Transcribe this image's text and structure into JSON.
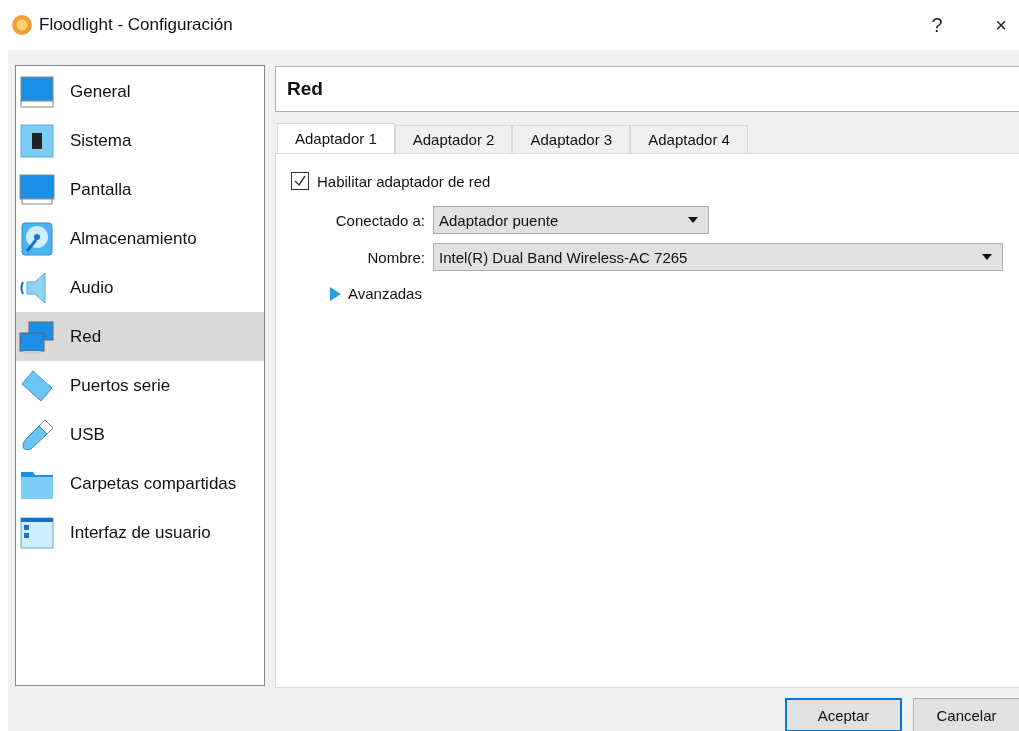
{
  "window": {
    "title": "Floodlight - Configuración",
    "buttons": [
      "?",
      "×"
    ]
  },
  "sidebar": {
    "items": [
      {
        "label": "General",
        "selected": false
      },
      {
        "label": "Sistema",
        "selected": false
      },
      {
        "label": "Pantalla",
        "selected": false
      },
      {
        "label": "Almacenamiento",
        "selected": false
      },
      {
        "label": "Audio",
        "selected": false
      },
      {
        "label": "Red",
        "selected": true
      },
      {
        "label": "Puertos serie",
        "selected": false
      },
      {
        "label": "USB",
        "selected": false
      },
      {
        "label": "Carpetas compartidas",
        "selected": false
      },
      {
        "label": "Interfaz de usuario",
        "selected": false
      }
    ]
  },
  "page": {
    "title": "Red",
    "tabs": [
      {
        "label": "Adaptador 1",
        "selected": true
      },
      {
        "label": "Adaptador 2",
        "selected": false
      },
      {
        "label": "Adaptador 3",
        "selected": false
      },
      {
        "label": "Adaptador 4",
        "selected": false
      }
    ],
    "enable": {
      "label": "Habilitar adaptador de red",
      "checked": true
    },
    "fields": [
      {
        "label": "Conectado a:",
        "value": "Adaptador puente",
        "wide": false
      },
      {
        "label": "Nombre:",
        "value": "Intel(R) Dual Band Wireless-AC 7265",
        "wide": true
      }
    ],
    "advanced": {
      "label": "Avanzadas",
      "expanded": false
    }
  },
  "buttons": [
    {
      "label": "Aceptar",
      "default": true
    },
    {
      "label": "Cancelar",
      "default": false
    }
  ]
}
